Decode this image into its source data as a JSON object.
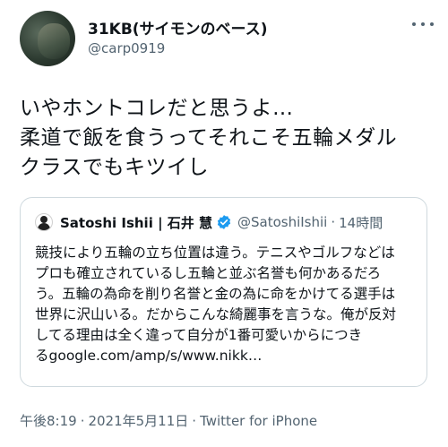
{
  "author": {
    "display_name": "31KB(サイモンのベース)",
    "handle": "@carp0919"
  },
  "tweet": {
    "lines": [
      "いやホントコレだと思うよ…",
      "柔道で飯を食うってそれこそ五輪メダル",
      "クラスでもキツイし"
    ]
  },
  "quote": {
    "name": "Satoshi Ishii | 石井 慧",
    "handle": "@SatoshiIshii",
    "separator": "·",
    "time": "14時間",
    "lines": [
      "競技により五輪の立ち位置は違う。テニスやゴルフなどは",
      "プロも確立されているし五輪と並ぶ名誉も何かあるだろ",
      "う。五輪の為命を削り名誉と金の為に命をかけてる選手は",
      "世界に沢山いる。だからこんな綺麗事を言うな。俺が反対",
      "してる理由は全く違って自分が1番可愛いからにつき",
      "るgoogle.com/amp/s/www.nikk…"
    ]
  },
  "meta": {
    "time": "午後8:19",
    "separator": "·",
    "date": "2021年5月11日",
    "source": "Twitter for iPhone"
  },
  "colors": {
    "text": "#0f1419",
    "secondary": "#536471",
    "border": "#cfd9de",
    "verified": "#1d9bf0"
  },
  "icons": {
    "more": "more-horizontal-icon",
    "verified": "verified-badge-icon"
  }
}
